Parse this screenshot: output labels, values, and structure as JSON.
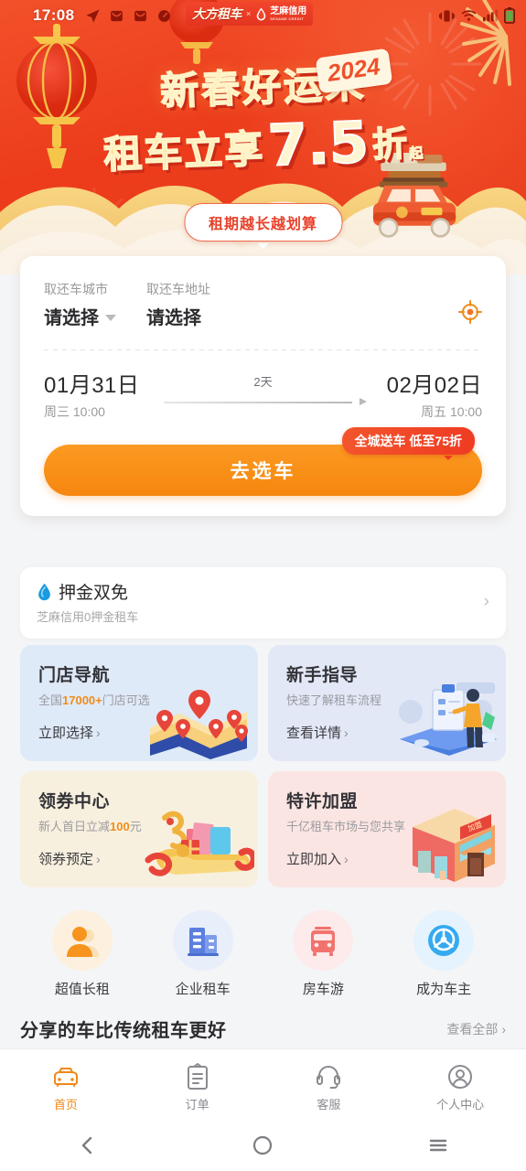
{
  "status_bar": {
    "time": "17:08",
    "left_icons": [
      "location-arrow-icon",
      "message-icon",
      "message-icon",
      "clock-icon"
    ],
    "right_icons": [
      "vibrate-icon",
      "wifi-icon",
      "signal-icon",
      "battery-icon"
    ],
    "logo": {
      "brand": "大方租车",
      "separator": "×",
      "partner_cn": "芝麻信用",
      "partner_en": "SESAME CREDIT"
    }
  },
  "banner": {
    "headline_line1": "新春好运来",
    "headline_line2_prefix": "租车立享",
    "headline_discount": "7.5",
    "headline_zhe": "折",
    "headline_qi": "起",
    "year_badge": "2024",
    "slogan_pill": "租期越长越划算",
    "bg_color": "#ec3c1c",
    "gold_color": "#ffd978"
  },
  "booking": {
    "city_label": "取还车城市",
    "city_value": "请选择",
    "address_label": "取还车地址",
    "address_value": "请选择",
    "locate_icon": "crosshair-locate-icon",
    "pickup": {
      "date": "01月31日",
      "detail": "周三 10:00"
    },
    "dropoff": {
      "date": "02月02日",
      "detail": "周五 10:00"
    },
    "duration": "2天",
    "cta_label": "去选车",
    "cta_badge": "全城送车 低至75折",
    "cta_color": "#f6860f"
  },
  "deposit": {
    "icon": "sesame-drop-icon",
    "title": "押金双免",
    "subtitle": "芝麻信用0押金租车",
    "chevron": "›"
  },
  "feature_cards": [
    {
      "title": "门店导航",
      "sub_prefix": "全国",
      "sub_highlight": "17000+",
      "sub_suffix": "门店可选",
      "link": "立即选择",
      "art": "map-pins-art",
      "bg": "#dfeaf8"
    },
    {
      "title": "新手指导",
      "sub_prefix": "快速了解租车流程",
      "sub_highlight": "",
      "sub_suffix": "",
      "link": "查看详情",
      "art": "guide-person-art",
      "bg": "#e2e8f6"
    },
    {
      "title": "领券中心",
      "sub_prefix": "新人首日立减",
      "sub_highlight": "100",
      "sub_suffix": "元",
      "link": "领券预定",
      "art": "gift-box-art",
      "bg": "#f8f0de"
    },
    {
      "title": "特许加盟",
      "sub_prefix": "千亿租车市场与您共享",
      "sub_highlight": "",
      "sub_suffix": "",
      "link": "立即加入",
      "art": "storefront-art",
      "bg": "#fbe5e2"
    }
  ],
  "quick_links": [
    {
      "label": "超值长租",
      "icon": "person-orange-icon",
      "circle": "#fdf0de",
      "color": "#f6941e"
    },
    {
      "label": "企业租车",
      "icon": "buildings-blue-icon",
      "circle": "#e9eefb",
      "color": "#5b7fe0"
    },
    {
      "label": "房车游",
      "icon": "rv-bus-red-icon",
      "circle": "#fdeaea",
      "color": "#f2736e"
    },
    {
      "label": "成为车主",
      "icon": "steering-wheel-icon",
      "circle": "#e4f3fd",
      "color": "#35aaf0"
    }
  ],
  "section": {
    "title": "分享的车比传统租车更好",
    "more": "查看全部",
    "more_chevron": "›"
  },
  "tabbar": [
    {
      "label": "首页",
      "icon": "taxi-icon",
      "active": true
    },
    {
      "label": "订单",
      "icon": "clipboard-icon",
      "active": false
    },
    {
      "label": "客服",
      "icon": "headset-icon",
      "active": false
    },
    {
      "label": "个人中心",
      "icon": "user-circle-icon",
      "active": false
    }
  ],
  "system_nav": [
    {
      "name": "back-icon"
    },
    {
      "name": "home-icon"
    },
    {
      "name": "recents-icon"
    }
  ]
}
